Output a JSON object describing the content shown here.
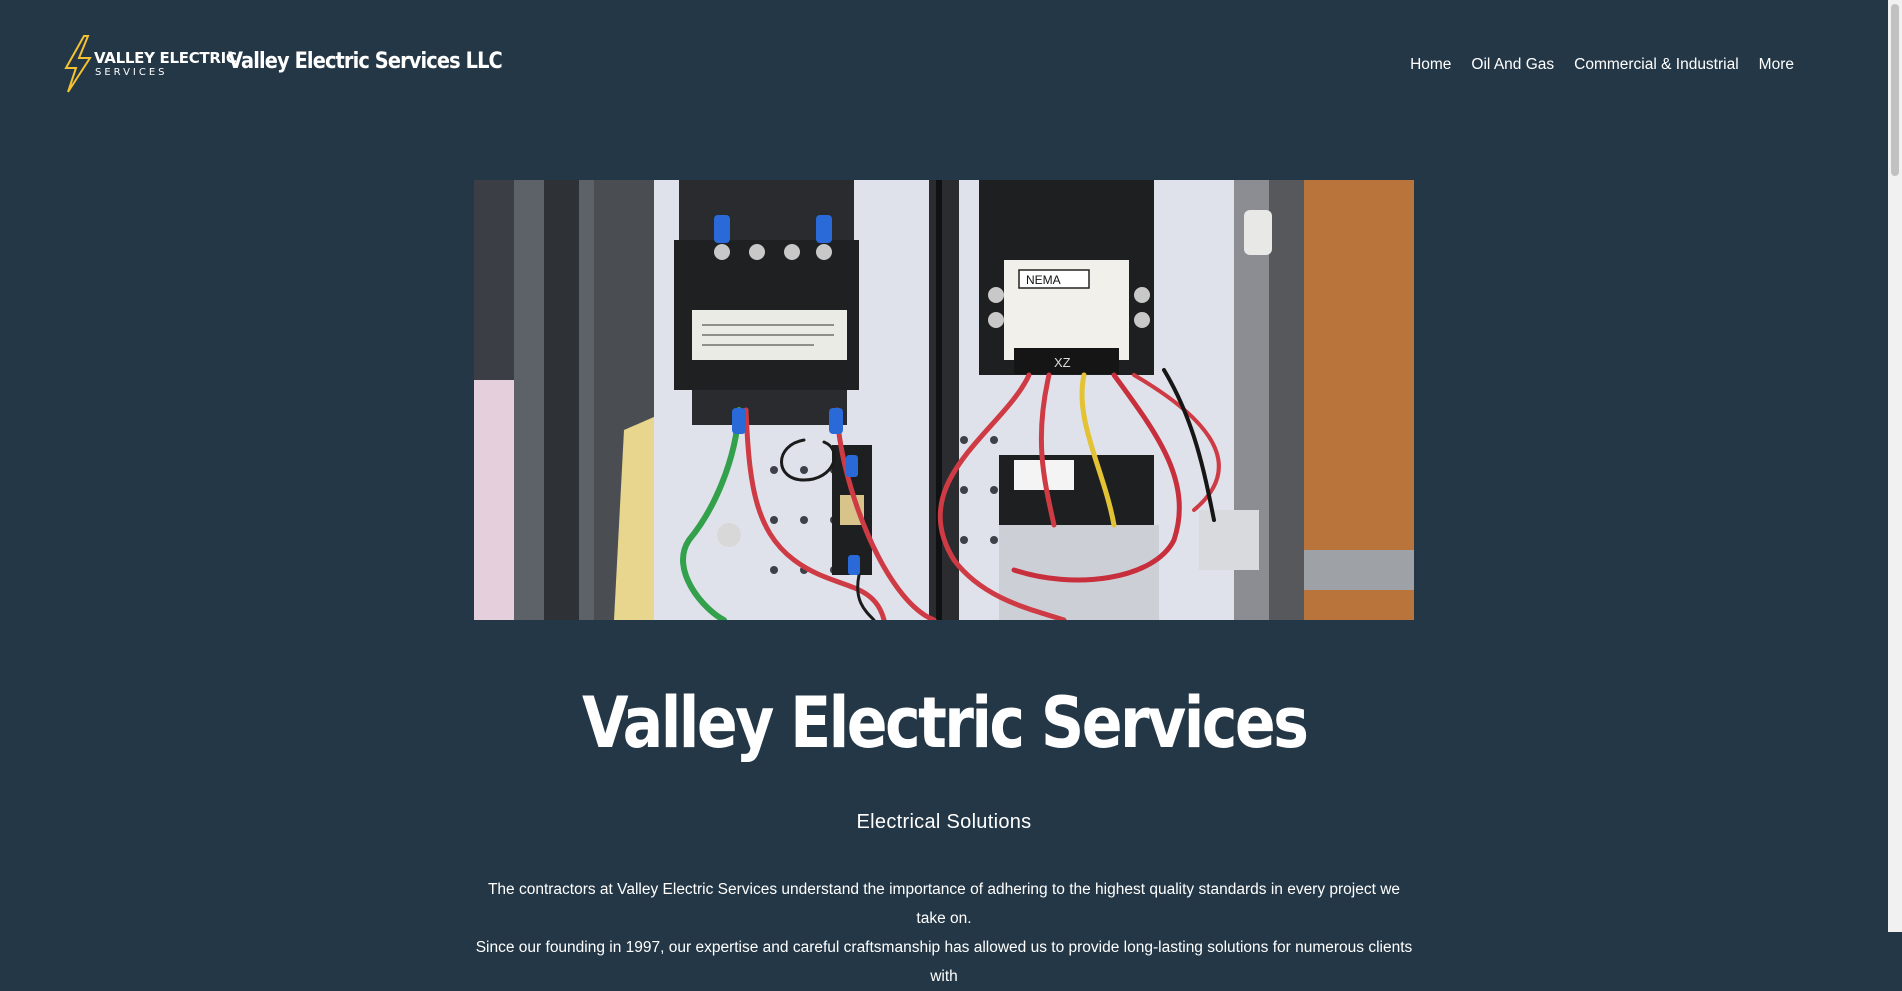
{
  "header": {
    "logo_line1": "VALLEY ELECTRIC",
    "logo_line2": "SERVICES",
    "site_title": "Valley Electric Services LLC"
  },
  "nav": {
    "items": [
      "Home",
      "Oil And Gas",
      "Commercial & Industrial",
      "More"
    ]
  },
  "hero": {
    "label_nema": "NEMA",
    "label_xz": "XZ"
  },
  "main": {
    "headline": "Valley Electric Services",
    "subheading": "Electrical Solutions",
    "paragraph_line1": "The contractors at Valley Electric Services understand the importance of adhering to the highest quality standards in every project we take on.",
    "paragraph_line2": "Since our founding in 1997, our expertise and careful craftsmanship has allowed us to provide long-lasting solutions for numerous clients with"
  },
  "colors": {
    "background": "#243746",
    "text": "#ffffff",
    "logo_bolt": "#f2c230"
  }
}
